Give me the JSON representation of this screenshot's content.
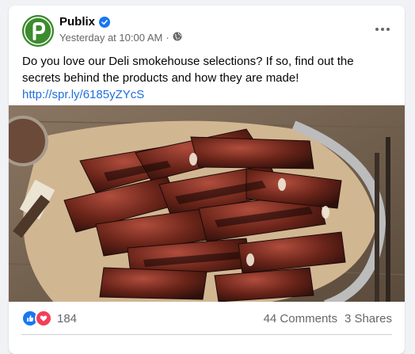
{
  "post": {
    "page_name": "Publix",
    "timestamp": "Yesterday at 10:00 AM",
    "separator": "·",
    "privacy_icon": "globe-icon",
    "text": "Do you love our Deli smokehouse selections? If so, find out the secrets behind the products and how they are made!",
    "link": "http://spr.ly/6185yZYcS",
    "avatar_letter": "p",
    "image_alt": "Smoked ribs on parchment paper"
  },
  "stats": {
    "reaction_count": "184",
    "comments": "44 Comments",
    "shares": "3 Shares",
    "reaction_icons": [
      "like-icon",
      "love-icon"
    ]
  },
  "colors": {
    "brand": "#3d8b2f",
    "verified": "#1877f2",
    "link": "#216fdb",
    "like": "#1877f2",
    "love": "#f33e58"
  }
}
